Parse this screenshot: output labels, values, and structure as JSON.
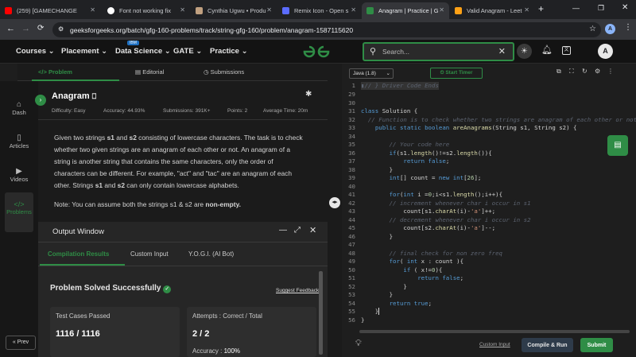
{
  "browser": {
    "tabs": [
      {
        "label": "(259) [GAMECHANGE",
        "color": "#ff0000"
      },
      {
        "label": "Font not working fix",
        "color": "#ffffff"
      },
      {
        "label": "Cynthia Ugwu • Produ",
        "color": "#c0a080"
      },
      {
        "label": "Remix Icon - Open s",
        "color": "#5b6cff"
      },
      {
        "label": "Anagram | Practice | G",
        "color": "#2f8d46"
      },
      {
        "label": "Valid Anagram - Leet",
        "color": "#ffa116"
      }
    ],
    "url": "geeksforgeeks.org/batch/gfg-160-problems/track/string-gfg-160/problem/anagram-1587115620",
    "profile_initial": "A"
  },
  "site": {
    "nav": [
      "Courses",
      "Placement",
      "Data Science",
      "GATE",
      "Practice"
    ],
    "ibm_badge": "IBM",
    "search_placeholder": "Search...",
    "avatar": "A"
  },
  "problem_tabs": [
    "Problem",
    "Editorial",
    "Submissions"
  ],
  "sidebar": [
    "Dash",
    "Articles",
    "Videos",
    "Problems"
  ],
  "prev_label": "Prev",
  "problem": {
    "title": "Anagram",
    "difficulty": "Difficulty: Easy",
    "accuracy": "Accuracy: 44.93%",
    "submissions": "Submissions: 391K+",
    "points": "Points: 2",
    "avg_time": "Average Time: 20m",
    "desc1_a": "Given two strings ",
    "desc1_b": "s1",
    "desc1_c": " and ",
    "desc1_d": "s2",
    "desc1_e": " consisting of lowercase characters. The task is to check",
    "desc2": "whether two given strings are an anagram of each other or not. An anagram of a",
    "desc3": "string is another string that contains the same characters, only the order of",
    "desc4": "characters can be different. For example, \"act\" and \"tac\" are an anagram of each",
    "desc5_a": "other. Strings ",
    "desc5_b": "s1",
    "desc5_c": " and ",
    "desc5_d": "s2",
    "desc5_e": " can only contain lowercase alphabets.",
    "note_a": "Note: You can assume both the strings s1 & s2 are ",
    "note_b": "non-empty."
  },
  "output": {
    "title": "Output Window",
    "tabs": [
      "Compilation Results",
      "Custom Input",
      "Y.O.G.I. (AI Bot)"
    ],
    "status": "Problem Solved Successfully",
    "suggest": "Suggest Feedback",
    "tests_label": "Test Cases Passed",
    "tests_value": "1116 / 1116",
    "attempts_label": "Attempts : Correct / Total",
    "attempts_value": "2 / 2",
    "accuracy_label": "Accuracy : ",
    "accuracy_value": "100%"
  },
  "editor": {
    "language": "Java (1.8)",
    "timer": "Start Timer",
    "custom_input": "Custom Input",
    "compile": "Compile & Run",
    "submit": "Submit"
  }
}
